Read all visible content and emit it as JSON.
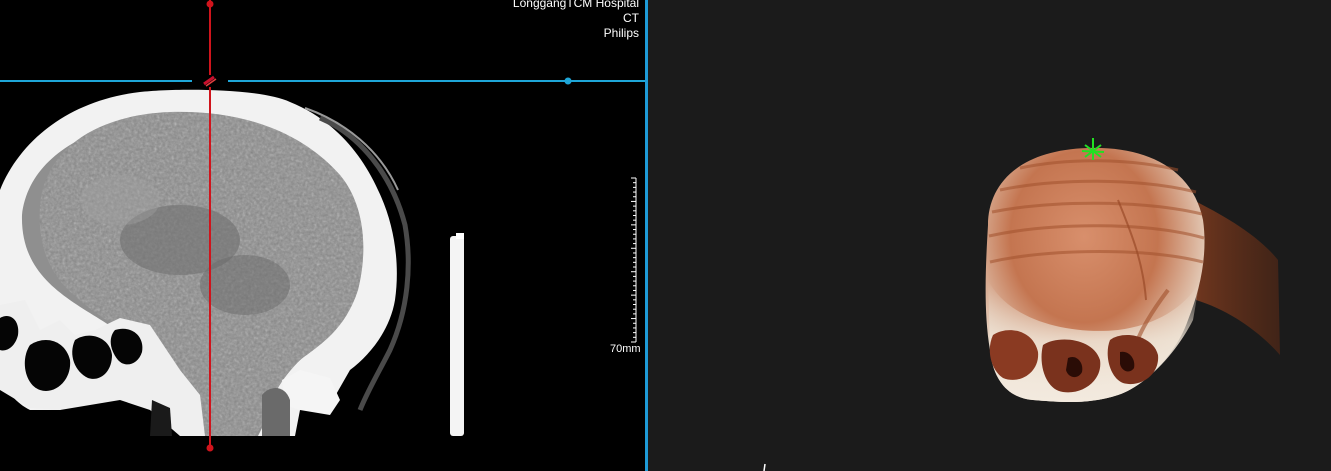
{
  "overlay": {
    "hospital": "LonggangTCM Hospital",
    "modality": "CT",
    "manufacturer": "Philips"
  },
  "scale_bar": {
    "label": "70mm"
  },
  "colors": {
    "horizontal_crosshair": "#1ea6d8",
    "vertical_crosshair": "#d0141c",
    "divider": "#1e9ad6",
    "marker_3d": "#22e022",
    "volume_tint": "#b4603e"
  },
  "icons": {
    "rotate_handle": "rotate-handle-icon",
    "marker_3d": "crosshair-marker-icon"
  }
}
